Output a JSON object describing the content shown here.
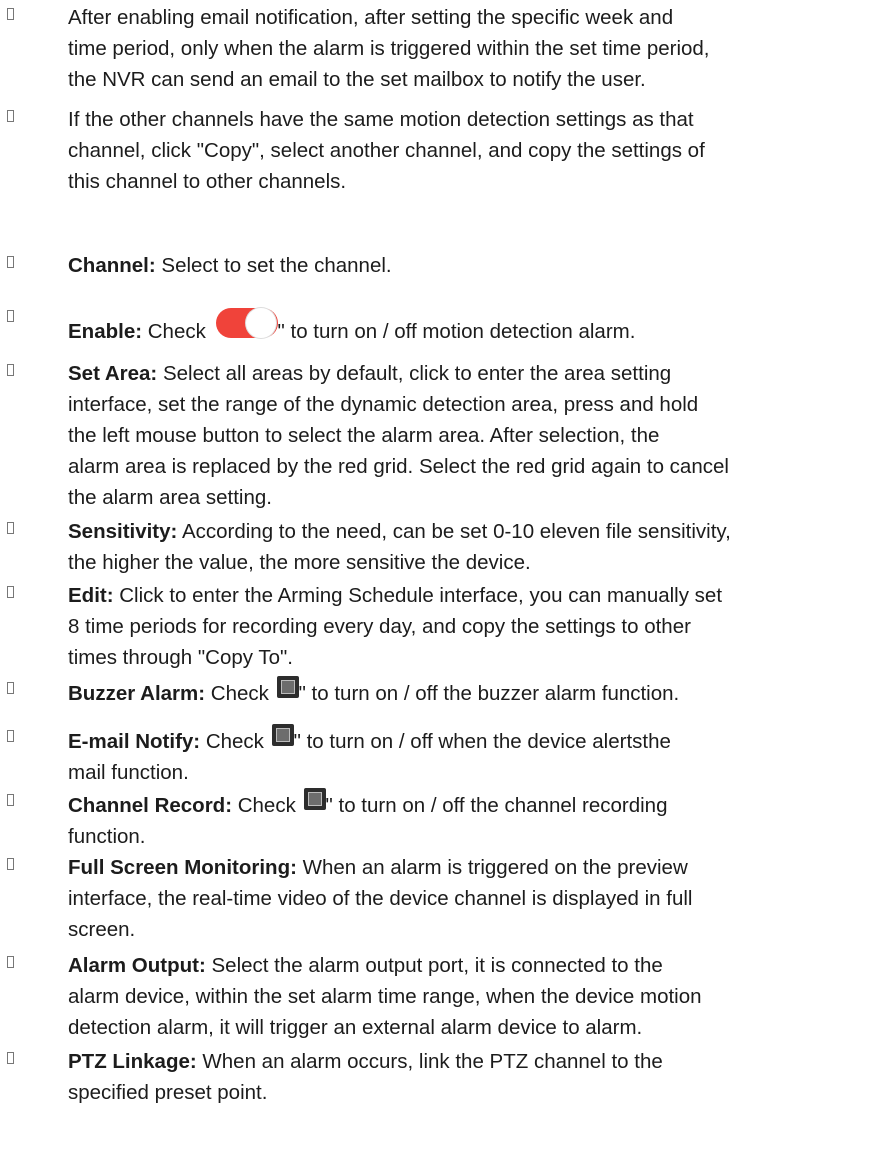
{
  "items": [
    {
      "lines": [
        "After enabling email notification, after setting the specific week and",
        "time period, only when the alarm is triggered within the set time period,",
        "the NVR can send an email to the set mailbox to notify the user."
      ]
    },
    {
      "lines": [
        "If the other channels have the same motion detection settings as that",
        "channel, click \"Copy\", select another channel, and copy the settings of",
        "this channel to other channels."
      ]
    },
    {
      "label": "Channel:",
      "lines": [
        " Select to set the channel."
      ]
    },
    {
      "label": "Enable:",
      "pre": " Check ",
      "post": "\" to turn on / off motion detection alarm.",
      "icon": "toggle-switch-icon"
    },
    {
      "label": "Set Area:",
      "lines": [
        " Select all areas by default, click to enter the area setting",
        "interface, set the range of the dynamic detection area, press and hold",
        "the left mouse button to select the alarm area. After selection, the",
        "alarm area is replaced by the red grid. Select the red grid again to cancel",
        "the alarm area setting."
      ]
    },
    {
      "label": "Sensitivity:",
      "lines": [
        " According to the need, can be set 0-10 eleven file sensitivity,",
        "the higher the value, the more sensitive the device."
      ]
    },
    {
      "label": "Edit:",
      "lines": [
        " Click to enter the Arming Schedule interface, you can manually set",
        "8 time periods for recording every day, and copy the settings to other",
        "times through \"Copy To\"."
      ]
    },
    {
      "label": "Buzzer Alarm:",
      "pre": " Check ",
      "post": "\" to turn on / off the buzzer alarm function.",
      "icon": "checkbox-icon"
    },
    {
      "label": "E-mail Notify:",
      "pre": " Check ",
      "post": "\" to turn on / off when the device alertsthe",
      "icon": "checkbox-icon",
      "lines2": [
        "mail function."
      ]
    },
    {
      "label": "Channel Record:",
      "pre": " Check ",
      "post": "\" to turn on / off the channel recording",
      "icon": "checkbox-icon",
      "lines2": [
        "function."
      ]
    },
    {
      "label": "Full Screen Monitoring:",
      "lines": [
        " When an alarm is triggered on the preview",
        "interface, the real-time video of the device channel is displayed in full",
        "screen."
      ]
    },
    {
      "label": "Alarm Output:",
      "lines": [
        " Select the alarm output port, it is connected to the",
        "alarm device, within the set alarm time range, when the device motion",
        "detection alarm, it will trigger an external alarm device to alarm."
      ]
    },
    {
      "label": "PTZ Linkage:",
      "lines": [
        " When an alarm occurs, link the PTZ channel to the",
        "specified preset point."
      ]
    }
  ]
}
